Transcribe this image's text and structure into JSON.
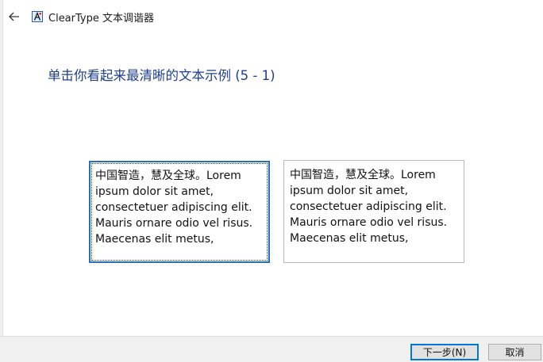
{
  "window": {
    "title": "ClearType 文本调谐器",
    "icon": "cleartype-app-icon"
  },
  "nav": {
    "back_icon": "back-arrow-icon"
  },
  "heading": "单击你看起来最清晰的文本示例 (5 - 1)",
  "samples": [
    {
      "text": "中国智造，慧及全球。Lorem\nipsum dolor sit amet,\nconsectetuer adipiscing elit.\nMauris ornare odio vel risus.\nMaecenas elit metus,",
      "selected": true
    },
    {
      "text": "中国智造，慧及全球。Lorem\nipsum dolor sit amet,\nconsectetuer adipiscing elit.\nMauris ornare odio vel risus.\nMaecenas elit metus,",
      "selected": false
    }
  ],
  "buttons": {
    "next_label": "下一步(N)",
    "cancel_label": "取消"
  },
  "colors": {
    "heading": "#1f3f8a",
    "selection_border": "#2d6fb5",
    "default_button_border": "#0078d7",
    "footer_bg": "#f0f0f0"
  }
}
